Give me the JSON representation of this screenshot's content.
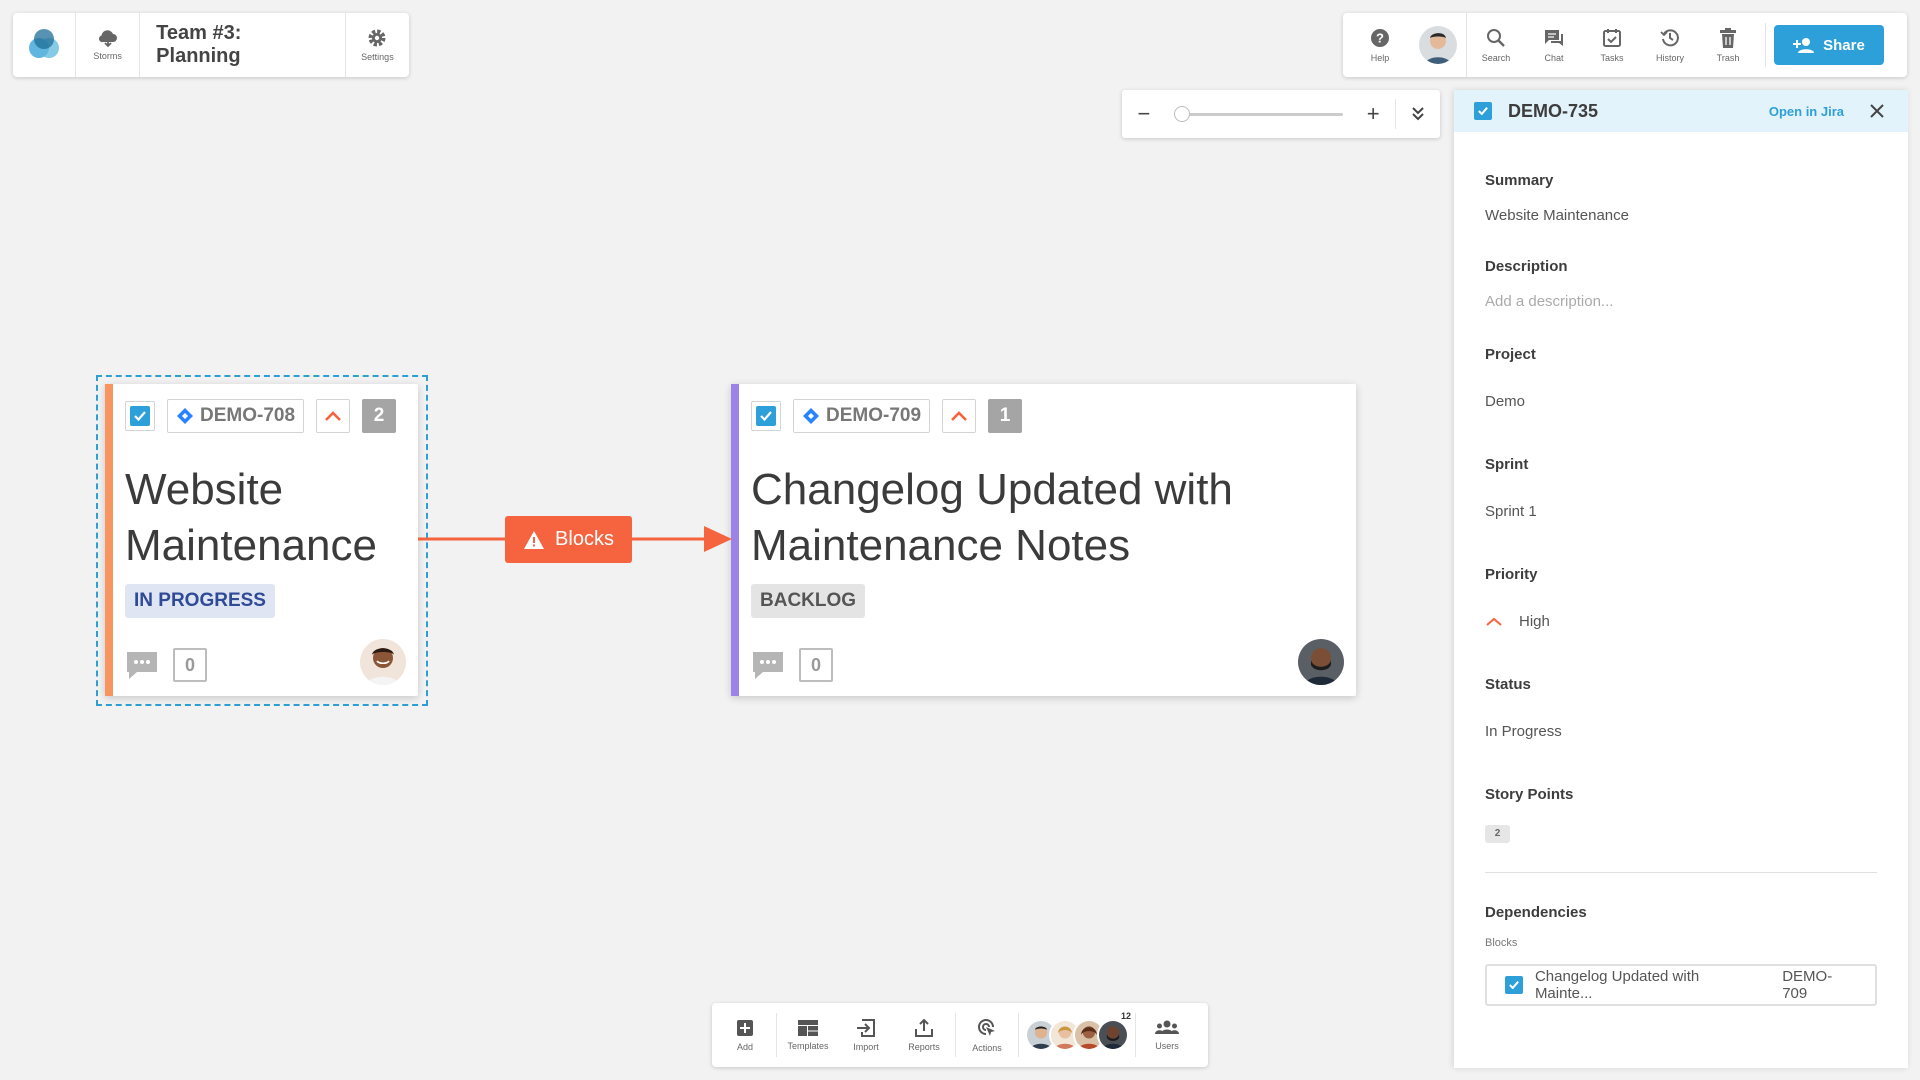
{
  "top_left_bar": {
    "storms_label": "Storms",
    "board_title": "Team #3: Planning",
    "settings_label": "Settings"
  },
  "top_right_bar": {
    "help_label": "Help",
    "search_label": "Search",
    "chat_label": "Chat",
    "tasks_label": "Tasks",
    "history_label": "History",
    "trash_label": "Trash",
    "share_label": "Share"
  },
  "zoom": {
    "minus": "−",
    "plus": "+",
    "level_fraction": 0.0
  },
  "cards": [
    {
      "key": "DEMO-708",
      "points": "2",
      "title_line1": "Website",
      "title_line2": "Maintenance",
      "status": "IN PROGRESS",
      "comments": "0",
      "stripe_color": "#f7945f",
      "status_bg": "#dfe5f3",
      "status_color": "#2f4a96"
    },
    {
      "key": "DEMO-709",
      "points": "1",
      "title_line1": "Changelog Updated with",
      "title_line2": "Maintenance Notes",
      "status": "BACKLOG",
      "comments": "0",
      "stripe_color": "#9b83e8",
      "status_bg": "#e4e4e4",
      "status_color": "#555555"
    }
  ],
  "connector": {
    "label": "Blocks",
    "color": "#f5633f"
  },
  "bottom_bar": {
    "add_label": "Add",
    "templates_label": "Templates",
    "import_label": "Import",
    "reports_label": "Reports",
    "actions_label": "Actions",
    "user_count": "12",
    "users_label": "Users"
  },
  "panel": {
    "key": "DEMO-735",
    "open_in_jira": "Open in Jira",
    "summary_label": "Summary",
    "summary_value": "Website Maintenance",
    "description_label": "Description",
    "description_placeholder": "Add a description...",
    "project_label": "Project",
    "project_value": "Demo",
    "sprint_label": "Sprint",
    "sprint_value": "Sprint 1",
    "priority_label": "Priority",
    "priority_value": "High",
    "status_label": "Status",
    "status_value": "In Progress",
    "story_points_label": "Story Points",
    "story_points_value": "2",
    "dependencies_label": "Dependencies",
    "blocks_label": "Blocks",
    "dep_title": "Changelog Updated with Mainte...",
    "dep_key": "DEMO-709"
  },
  "colors": {
    "accent": "#2d9fd9",
    "blocks": "#f5633f",
    "priority_high": "#f5633f"
  },
  "icons": [
    "logo-icon",
    "cloud-icon",
    "gear-icon",
    "help-icon",
    "search-icon",
    "chat-icon",
    "tasks-icon",
    "history-icon",
    "trash-icon",
    "add-user-icon",
    "minus-icon",
    "plus-icon",
    "chevron-double-down-icon",
    "checkbox-icon",
    "jira-icon",
    "priority-up-icon",
    "comment-icon",
    "warning-icon",
    "add-icon",
    "templates-icon",
    "import-icon",
    "reports-icon",
    "actions-icon",
    "users-icon",
    "close-icon"
  ]
}
